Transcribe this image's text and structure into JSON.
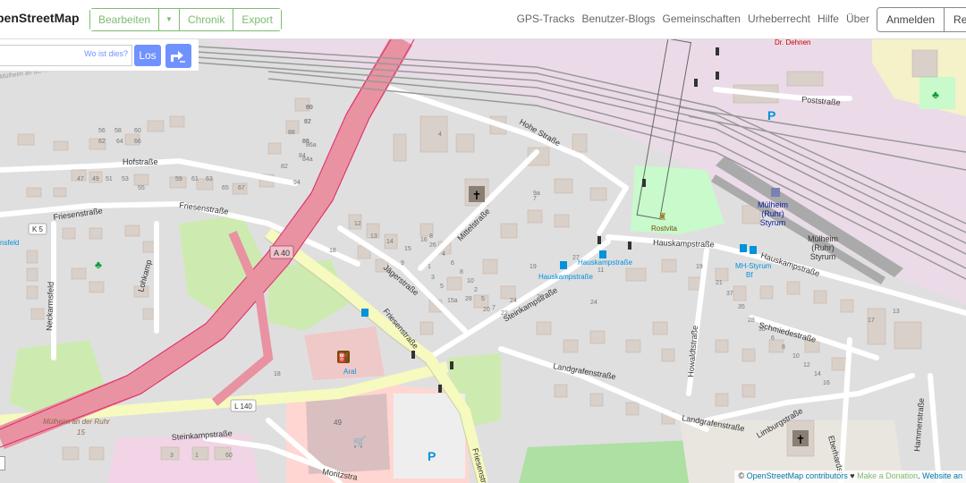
{
  "header": {
    "logo": "penStreetMap",
    "edit_label": "Bearbeiten",
    "history_label": "Chronik",
    "export_label": "Export",
    "nav": [
      "GPS-Tracks",
      "Benutzer-Blogs",
      "Gemeinschaften",
      "Urheberrecht",
      "Hilfe",
      "Über"
    ],
    "login_label": "Anmelden",
    "register_label": "Regis"
  },
  "search": {
    "whereis_label": "Wo ist dies?",
    "go_label": "Los"
  },
  "map_labels": {
    "hofstrasse": "Hofstraße",
    "friesenstrasse": "Friesenstraße",
    "friesenstrasse2": "Friesenstraße",
    "friesenstrasse3": "Friesenstraße",
    "k5": "K 5",
    "a40": "A 40",
    "l140": "L 140",
    "lohkamp": "Lohkamp",
    "neckarmsfeld": "Neckarmsfeld",
    "hohe_strasse": "Hohe Straße",
    "mittelstrasse": "Mittelstraße",
    "jaegerstrasse": "Jägerstraße",
    "steinkampstrasse": "Steinkampstraße",
    "steinkampstrasse2": "Steinkampstraße",
    "hauskampstrasse": "Hauskampstraße",
    "hauskampstrasse2": "Hauskampstraße",
    "hauskampstrasse_stop1": "Hauskampstraße",
    "hauskampstrasse_stop2": "Hauskampstraße",
    "poststrasse": "Poststraße",
    "rostvita": "Rostvita",
    "station1": "Mülheim",
    "station2": "(Ruhr)",
    "station3": "Styrum",
    "station_b1": "Mülheim",
    "station_b2": "(Ruhr)",
    "station_b3": "Styrum",
    "mh_styrum1": "MH-Styrum",
    "mh_styrum2": "Bf",
    "howaldtstrasse": "Howaldtstraße",
    "schmiedestrasse": "Schmiedestraße",
    "landgrafenstrasse": "Landgrafenstraße",
    "landgrafenstrasse2": "Landgrafenstraße",
    "limburgstrasse": "Limburgstraße",
    "eberhardstrasse": "Eberhardst",
    "hammerstrasse": "Hammerstraße",
    "moritzstrasse": "Moritzstra",
    "aral": "Aral",
    "dr_dehnen": "Dr. Dehnen",
    "muelheim_ruhr": "Mülheim an der Ruhr",
    "muelheim_ruhr_num": "15",
    "muelheim_top": "Mülheim an der Ruhr",
    "nsfeld": "nsfeld",
    "house_49": "49"
  },
  "house_numbers": [
    "90",
    "92",
    "86",
    "86a",
    "84",
    "84a",
    "88",
    "82",
    "62",
    "64",
    "66",
    "56",
    "58",
    "60",
    "47",
    "49",
    "51",
    "53",
    "55",
    "59",
    "61",
    "63",
    "65",
    "67",
    "94",
    "4",
    "12",
    "13",
    "14",
    "15",
    "16",
    "8",
    "9",
    "18",
    "1",
    "3",
    "5",
    "7",
    "9a",
    "15a",
    "28",
    "20",
    "22",
    "24",
    "26",
    "27",
    "11",
    "19",
    "24",
    "26",
    "4",
    "6",
    "8",
    "10",
    "2",
    "5",
    "7",
    "13",
    "17",
    "19",
    "21",
    "37",
    "35",
    "28",
    "30",
    "6",
    "8",
    "10",
    "12",
    "14",
    "16",
    "18",
    "3",
    "1",
    "60",
    "69",
    "67",
    "63"
  ],
  "attribution": {
    "prefix": "©",
    "osm_link": "OpenStreetMap contributors",
    "heart": "♥",
    "donate_link": "Make a Donation",
    "website_link": "Website an"
  },
  "colors": {
    "brand": "#7ebc6f",
    "link": "#7092ff",
    "motorway": "#e892a2",
    "primary": "#fcd6a4",
    "secondary": "#f7fabf",
    "background": "#f2efe9",
    "building": "#d9d0c9",
    "residential": "#e0dfdf",
    "park": "#c8facc",
    "rail_area": "#ebdbe8"
  }
}
